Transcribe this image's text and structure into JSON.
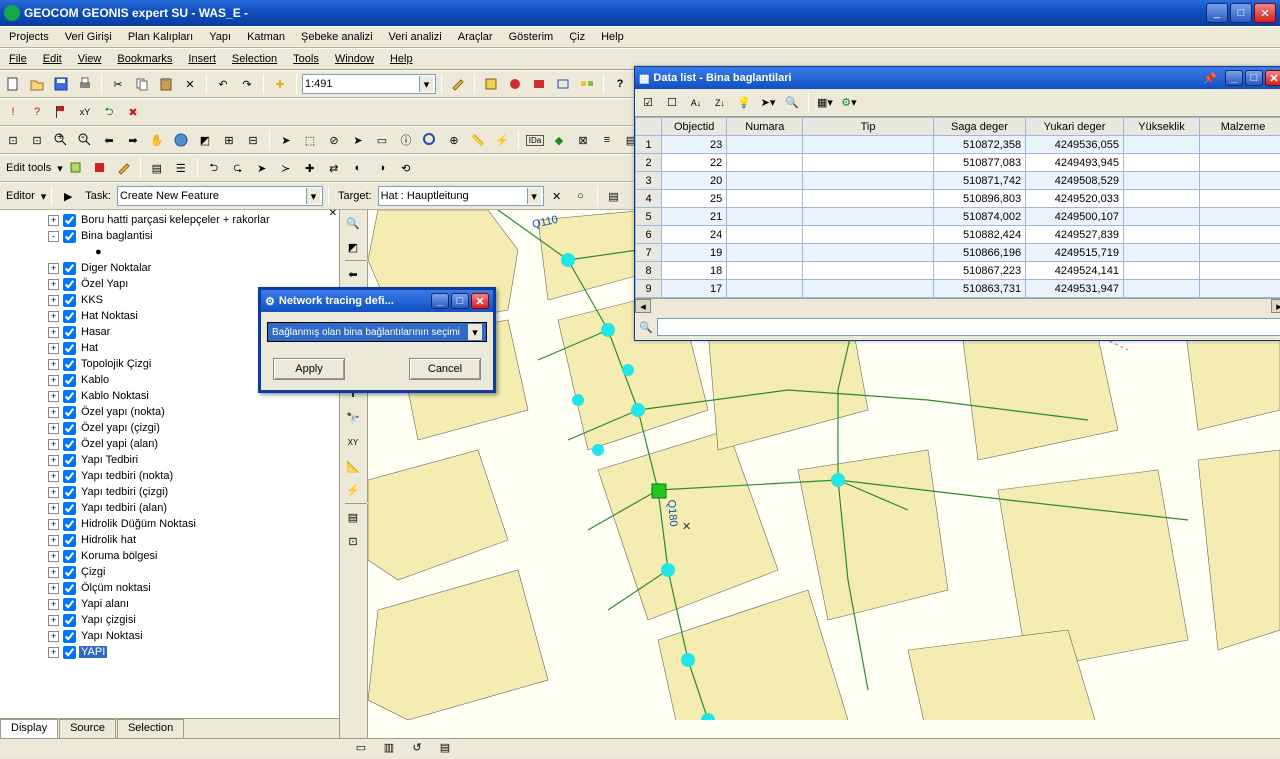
{
  "titlebar": {
    "title": "GEOCOM GEONIS expert SU - WAS_E -"
  },
  "menubar1": [
    "Projects",
    "Veri Girişi",
    "Plan Kalıpları",
    "Yapı",
    "Katman",
    "Şebeke analizi",
    "Veri analizi",
    "Araçlar",
    "Gösterim",
    "Çiz",
    "Help"
  ],
  "menubar2": [
    "File",
    "Edit",
    "View",
    "Bookmarks",
    "Insert",
    "Selection",
    "Tools",
    "Window",
    "Help"
  ],
  "scale": "1:491",
  "editor": {
    "editor_label": "Editor",
    "task_label": "Task:",
    "task_value": "Create New Feature",
    "target_label": "Target:",
    "target_value": "Hat : Hauptleitung",
    "edittools_label": "Edit tools"
  },
  "layers": [
    {
      "exp": "+",
      "chk": true,
      "label": "Boru hatti parçasi kelepçeler + rakorlar",
      "indent": 46
    },
    {
      "exp": "-",
      "chk": true,
      "label": "Bina baglantisi",
      "indent": 46
    },
    {
      "exp": "",
      "chk": null,
      "label": "●",
      "indent": 76
    },
    {
      "exp": "+",
      "chk": true,
      "label": "Diger Noktalar",
      "indent": 46
    },
    {
      "exp": "+",
      "chk": true,
      "label": "Özel Yapı",
      "indent": 46
    },
    {
      "exp": "+",
      "chk": true,
      "label": "KKS",
      "indent": 46
    },
    {
      "exp": "+",
      "chk": true,
      "label": "Hat Noktasi",
      "indent": 46
    },
    {
      "exp": "+",
      "chk": true,
      "label": "Hasar",
      "indent": 46
    },
    {
      "exp": "+",
      "chk": true,
      "label": "Hat",
      "indent": 46
    },
    {
      "exp": "+",
      "chk": true,
      "label": "Topolojik Çizgi",
      "indent": 46
    },
    {
      "exp": "+",
      "chk": true,
      "label": "Kablo",
      "indent": 46
    },
    {
      "exp": "+",
      "chk": true,
      "label": "Kablo Noktasi",
      "indent": 46
    },
    {
      "exp": "+",
      "chk": true,
      "label": "Özel yapı (nokta)",
      "indent": 46
    },
    {
      "exp": "+",
      "chk": true,
      "label": "Özel yapı (çizgi)",
      "indent": 46
    },
    {
      "exp": "+",
      "chk": true,
      "label": "Özel yapi (alan)",
      "indent": 46
    },
    {
      "exp": "+",
      "chk": true,
      "label": "Yapı Tedbiri",
      "indent": 46
    },
    {
      "exp": "+",
      "chk": true,
      "label": "Yapı tedbiri (nokta)",
      "indent": 46
    },
    {
      "exp": "+",
      "chk": true,
      "label": "Yapı tedbiri (çizgi)",
      "indent": 46
    },
    {
      "exp": "+",
      "chk": true,
      "label": "Yapı tedbiri (alan)",
      "indent": 46
    },
    {
      "exp": "+",
      "chk": true,
      "label": "Hidrolik Düğüm Noktasi",
      "indent": 46
    },
    {
      "exp": "+",
      "chk": true,
      "label": "Hidrolik hat",
      "indent": 46
    },
    {
      "exp": "+",
      "chk": true,
      "label": "Koruma bölgesi",
      "indent": 46
    },
    {
      "exp": "+",
      "chk": true,
      "label": "Çizgi",
      "indent": 46
    },
    {
      "exp": "+",
      "chk": true,
      "label": "Ölçüm noktasi",
      "indent": 46
    },
    {
      "exp": "+",
      "chk": true,
      "label": "Yapi alanı",
      "indent": 46
    },
    {
      "exp": "+",
      "chk": true,
      "label": "Yapı çizgisi",
      "indent": 46
    },
    {
      "exp": "+",
      "chk": true,
      "label": "Yapı Noktasi",
      "indent": 46
    },
    {
      "exp": "+",
      "chk": true,
      "label": "YAPI",
      "indent": 46,
      "selected": true
    }
  ],
  "layertabs": [
    "Display",
    "Source",
    "Selection"
  ],
  "maplabels": {
    "q110": "Q110",
    "q180": "Q180"
  },
  "netdlg": {
    "title": "Network tracing defi...",
    "option": "Bağlanmış olan bina bağlantılarının seçimi",
    "apply": "Apply",
    "cancel": "Cancel"
  },
  "datalist": {
    "title": "Data list - Bina baglantilari",
    "columns": [
      "Objectid",
      "Numara",
      "Tip",
      "Saga deger",
      "Yukari deger",
      "Yükseklik",
      "Malzeme"
    ],
    "rows": [
      {
        "n": "1",
        "Objectid": "23",
        "Numara": "",
        "Tip": "",
        "Saga": "510872,358",
        "Yukari": "4249536,055",
        "Yuk": "",
        "Mal": ""
      },
      {
        "n": "2",
        "Objectid": "22",
        "Numara": "",
        "Tip": "",
        "Saga": "510877,083",
        "Yukari": "4249493,945",
        "Yuk": "",
        "Mal": ""
      },
      {
        "n": "3",
        "Objectid": "20",
        "Numara": "",
        "Tip": "",
        "Saga": "510871,742",
        "Yukari": "4249508,529",
        "Yuk": "",
        "Mal": ""
      },
      {
        "n": "4",
        "Objectid": "25",
        "Numara": "",
        "Tip": "",
        "Saga": "510896,803",
        "Yukari": "4249520,033",
        "Yuk": "",
        "Mal": ""
      },
      {
        "n": "5",
        "Objectid": "21",
        "Numara": "",
        "Tip": "",
        "Saga": "510874,002",
        "Yukari": "4249500,107",
        "Yuk": "",
        "Mal": ""
      },
      {
        "n": "6",
        "Objectid": "24",
        "Numara": "",
        "Tip": "",
        "Saga": "510882,424",
        "Yukari": "4249527,839",
        "Yuk": "",
        "Mal": ""
      },
      {
        "n": "7",
        "Objectid": "19",
        "Numara": "",
        "Tip": "",
        "Saga": "510866,196",
        "Yukari": "4249515,719",
        "Yuk": "",
        "Mal": ""
      },
      {
        "n": "8",
        "Objectid": "18",
        "Numara": "",
        "Tip": "",
        "Saga": "510867,223",
        "Yukari": "4249524,141",
        "Yuk": "",
        "Mal": ""
      },
      {
        "n": "9",
        "Objectid": "17",
        "Numara": "",
        "Tip": "",
        "Saga": "510863,731",
        "Yukari": "4249531,947",
        "Yuk": "",
        "Mal": ""
      }
    ]
  }
}
